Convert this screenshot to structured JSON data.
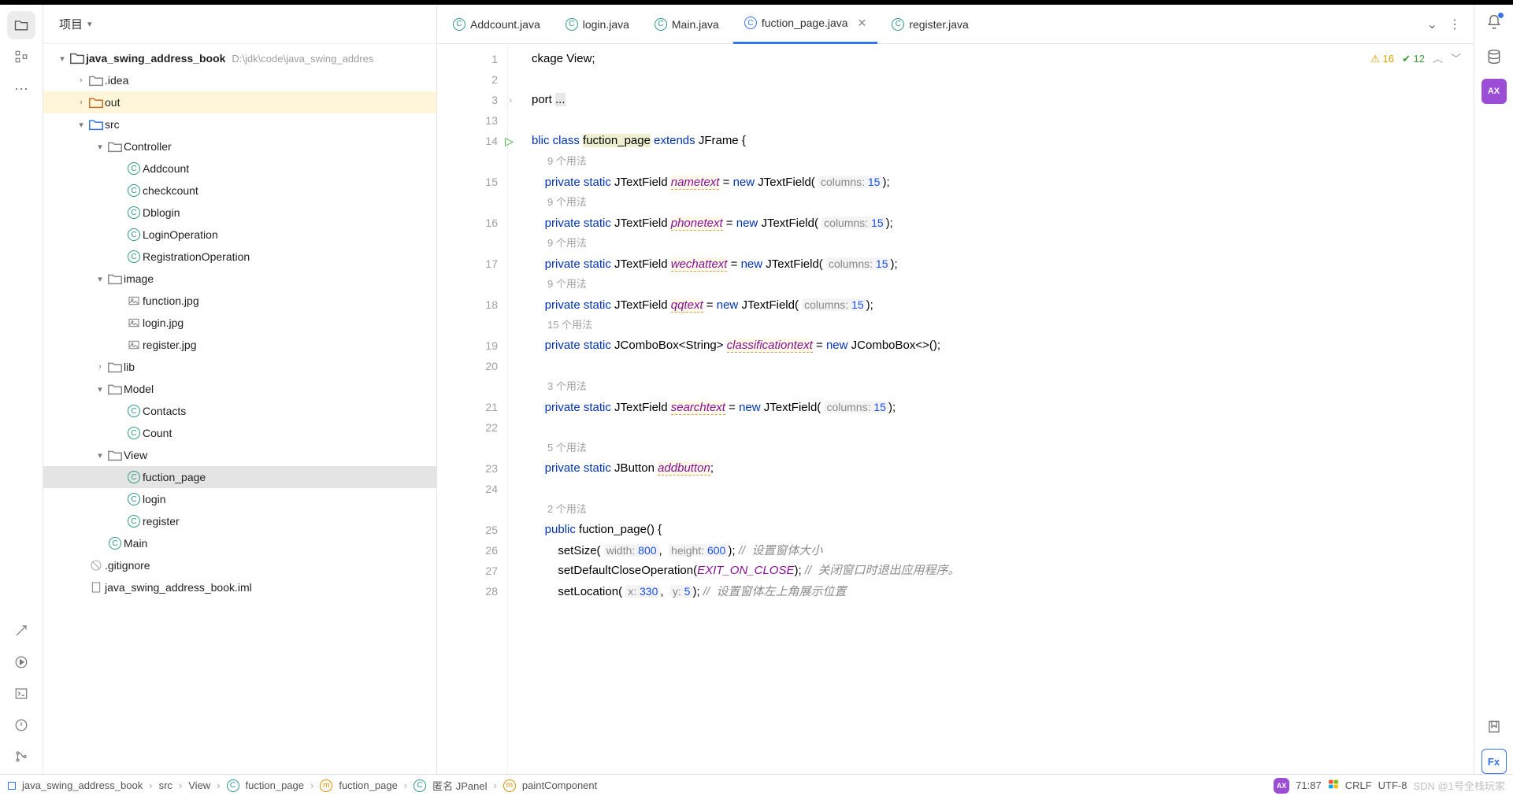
{
  "header": {
    "title": "项目"
  },
  "tree": {
    "root": {
      "name": "java_swing_address_book",
      "path": "D:\\jdk\\code\\java_swing_addres"
    },
    "idea": ".idea",
    "out": "out",
    "src": "src",
    "controller": "Controller",
    "controller_items": [
      "Addcount",
      "checkcount",
      "Dblogin",
      "LoginOperation",
      "RegistrationOperation"
    ],
    "image": "image",
    "image_items": [
      "function.jpg",
      "login.jpg",
      "register.jpg"
    ],
    "lib": "lib",
    "model": "Model",
    "model_items": [
      "Contacts",
      "Count"
    ],
    "view": "View",
    "view_items": [
      "fuction_page",
      "login",
      "register"
    ],
    "main": "Main",
    "gitignore": ".gitignore",
    "iml": "java_swing_address_book.iml"
  },
  "tabs": [
    {
      "label": "Addcount.java",
      "active": false
    },
    {
      "label": "login.java",
      "active": false
    },
    {
      "label": "Main.java",
      "active": false
    },
    {
      "label": "fuction_page.java",
      "active": true
    },
    {
      "label": "register.java",
      "active": false
    }
  ],
  "inspections": {
    "warn": "16",
    "ok": "12"
  },
  "gutter": [
    "1",
    "2",
    "3",
    "13",
    "14",
    "",
    "15",
    "",
    "16",
    "",
    "17",
    "",
    "18",
    "",
    "19",
    "20",
    "",
    "21",
    "22",
    "",
    "23",
    "24",
    "",
    "25",
    "26",
    "27",
    "28"
  ],
  "hints": {
    "u9": "9 个用法",
    "u15": "15 个用法",
    "u3": "3 个用法",
    "u5": "5 个用法",
    "u2": "2 个用法",
    "cols": "columns:",
    "width": "width:",
    "height": "height:",
    "x": "x:",
    "y": "y:"
  },
  "code": {
    "l1_a": "ckage View;",
    "l3_a": "port ",
    "l3_b": "...",
    "l14_a": "blic class ",
    "l14_b": "fuction_page",
    "l14_c": " extends JFrame {",
    "priv": "private",
    "stat": "static",
    "new": "new",
    "pub": "public",
    "jtf": " JTextField ",
    "jtf2": "JTextField(",
    "jcb": " JComboBox<String> ",
    "jcb2": "JComboBox<>();",
    "jbtn": " JButton ",
    "f_name": "nametext",
    "f_phone": "phonetext",
    "f_wechat": "wechattext",
    "f_qq": "qqtext",
    "f_class": "classificationtext",
    "f_search": "searchtext",
    "f_add": "addbutton",
    "n15": "15",
    "fn": "fuction_page()",
    "brace": " {",
    "setsize": "setSize(",
    "w": "800",
    "h": "600",
    "c_setsize": "设置窗体大小",
    "setclose": "setDefaultCloseOperation(",
    "exit": "EXIT_ON_CLOSE",
    "c_close": "关闭窗口时退出应用程序。",
    "setloc": "setLocation(",
    "lx": "330",
    "ly": "5",
    "c_loc": "设置窗体左上角展示位置"
  },
  "breadcrumbs": [
    "java_swing_address_book",
    "src",
    "View",
    "fuction_page",
    "fuction_page",
    "匿名 JPanel",
    "paintComponent"
  ],
  "status": {
    "pos": "71:87",
    "sep": "CRLF",
    "enc": "UTF-8",
    "wm": "SDN @1号全栈玩家"
  }
}
